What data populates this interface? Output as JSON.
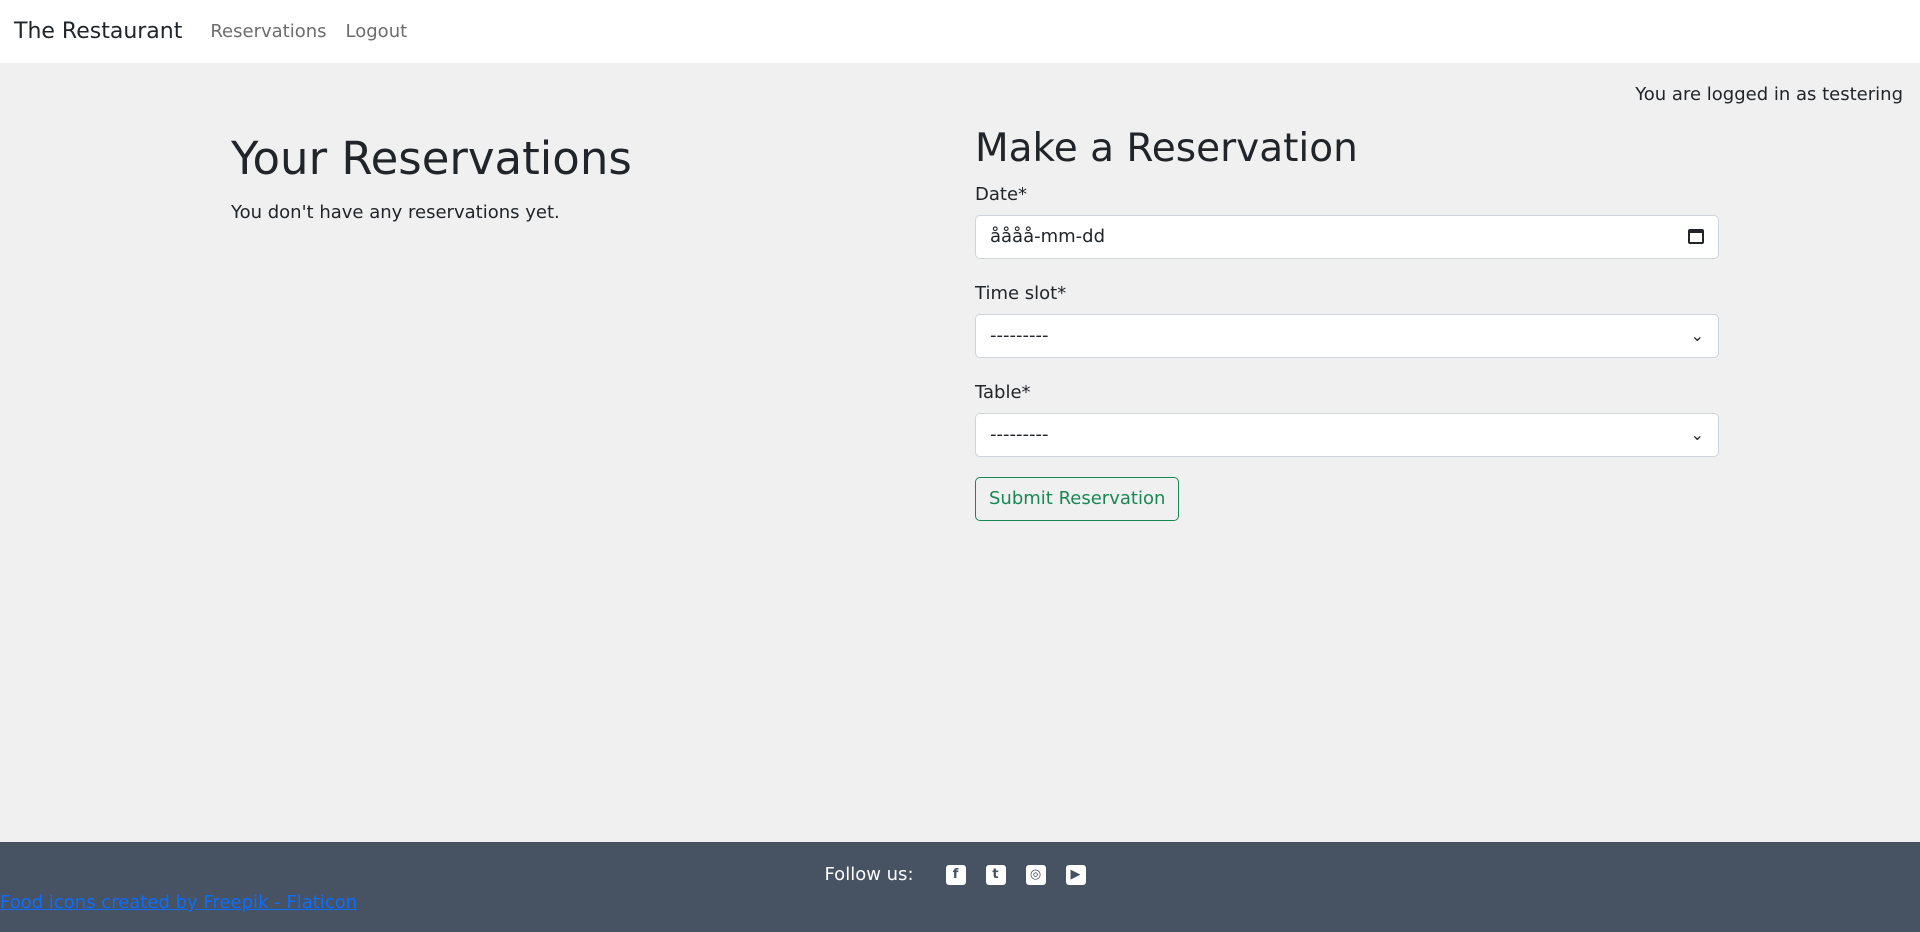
{
  "nav": {
    "brand": "The Restaurant",
    "links": [
      "Reservations",
      "Logout"
    ]
  },
  "status": {
    "login_text": "You are logged in as testering"
  },
  "reservations": {
    "title": "Your Reservations",
    "empty_text": "You don't have any reservations yet."
  },
  "form": {
    "title": "Make a Reservation",
    "date_label": "Date*",
    "date_value": "åååå-mm-dd",
    "timeslot_label": "Time slot*",
    "timeslot_value": "---------",
    "table_label": "Table*",
    "table_value": "---------",
    "submit_label": "Submit Reservation"
  },
  "footer": {
    "follow_text": "Follow us:",
    "social_icons": [
      "facebook-icon",
      "twitter-icon",
      "instagram-icon",
      "youtube-icon"
    ],
    "credit_link": "Food icons created by Freepik - Flaticon"
  },
  "colors": {
    "background": "#f0f0f0",
    "footer": "#475263",
    "submit": "#198754",
    "link": "#0d6efd"
  }
}
